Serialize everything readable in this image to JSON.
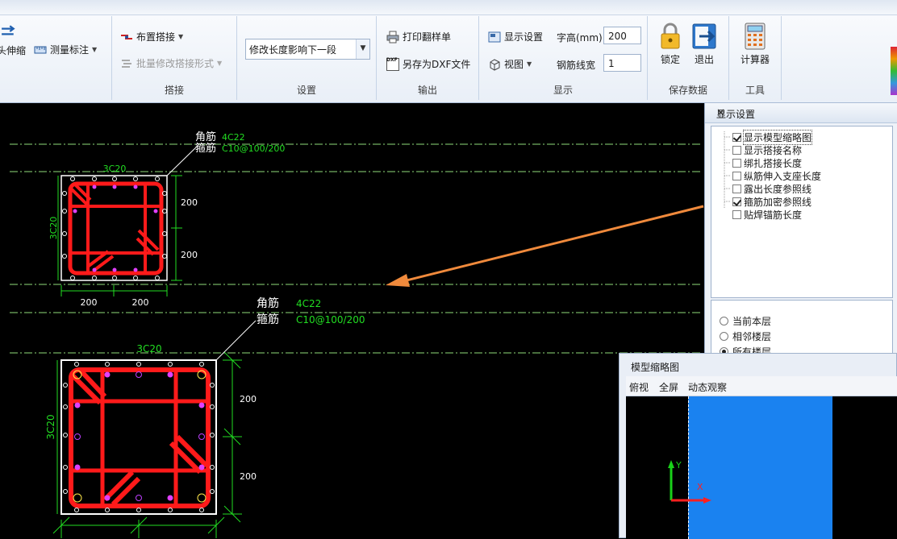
{
  "ribbon": {
    "group0": {
      "stretch_label": "头伸缩",
      "measure_label": "测量标注"
    },
    "lap": {
      "place_lap_label": "布置搭接",
      "batch_modify_label": "批量修改搭接形式",
      "group_label": "搭接"
    },
    "settings": {
      "mode_value": "修改长度影响下一段",
      "group_label": "设置"
    },
    "output": {
      "print_label": "打印翻样单",
      "save_dxf_label": "另存为DXF文件",
      "dxf_badge": "DXF",
      "group_label": "输出"
    },
    "display": {
      "display_settings_label": "显示设置",
      "view_label": "视图",
      "font_height_label": "字高(mm)",
      "font_height_value": "200",
      "rebar_width_label": "钢筋线宽",
      "rebar_width_value": "1",
      "group_label": "显示"
    },
    "save_data": {
      "lock_label": "锁定",
      "exit_label": "退出",
      "group_label": "保存数据"
    },
    "tools": {
      "calculator_label": "计算器",
      "group_label": "工具"
    }
  },
  "drawing": {
    "section1": {
      "corner_label": "角筋",
      "corner_value": "4C22",
      "stirrup_label": "箍筋",
      "stirrup_value": "C10@100/200",
      "top_bars": "3C20",
      "side_bars": "3C20",
      "dim_right_1": "200",
      "dim_right_2": "200",
      "dim_bottom_1": "200",
      "dim_bottom_2": "200"
    },
    "section2": {
      "corner_label": "角筋",
      "corner_value": "4C22",
      "stirrup_label": "箍筋",
      "stirrup_value": "C10@100/200",
      "top_bars": "3C20",
      "side_bars": "3C20",
      "dim_right_1": "200",
      "dim_right_2": "200"
    }
  },
  "display_panel": {
    "title": "显示设置",
    "close_glyph": "✕",
    "options": [
      {
        "label": "显示模型缩略图",
        "checked": true
      },
      {
        "label": "显示搭接名称",
        "checked": false
      },
      {
        "label": "绑扎搭接长度",
        "checked": false
      },
      {
        "label": "纵筋伸入支座长度",
        "checked": false
      },
      {
        "label": "露出长度参照线",
        "checked": false
      },
      {
        "label": "箍筋加密参照线",
        "checked": true
      },
      {
        "label": "贴焊锚筋长度",
        "checked": false
      }
    ],
    "floor_options": [
      {
        "label": "当前本层",
        "selected": false
      },
      {
        "label": "相邻楼层",
        "selected": false
      },
      {
        "label": "所有楼层",
        "selected": true
      }
    ]
  },
  "thumbnail": {
    "title": "模型缩略图",
    "tabs": [
      "俯视",
      "全屏",
      "动态观察"
    ],
    "axis_y": "Y",
    "axis_x": "X"
  },
  "colors": {
    "rebar": "#ff1a1a",
    "cad_text": "#ffffff",
    "cad_green": "#22dd22",
    "guide": "#7fd86b",
    "arrow": "#f08a3c",
    "model_blue": "#1a82f0"
  }
}
